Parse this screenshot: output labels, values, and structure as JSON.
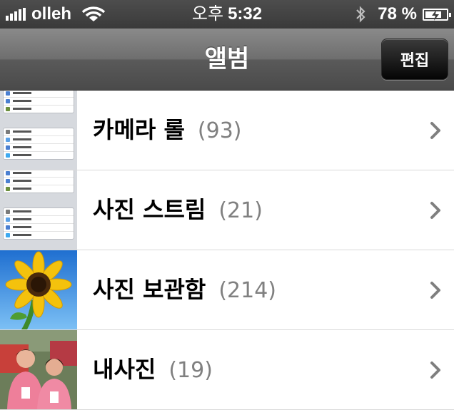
{
  "status_bar": {
    "carrier": "olleh",
    "ampm": "오후",
    "time": "5:32",
    "battery_percent": "78 %",
    "battery_level": 0.78,
    "icons": [
      "signal-bars-icon",
      "wifi-icon",
      "bluetooth-icon",
      "battery-charging-icon"
    ]
  },
  "nav": {
    "title": "앨범",
    "edit_label": "편집"
  },
  "albums": [
    {
      "name": "카메라 롤",
      "count": "(93)",
      "thumbnail": "settings-screenshot"
    },
    {
      "name": "사진 스트림",
      "count": "(21)",
      "thumbnail": "settings-screenshot"
    },
    {
      "name": "사진 보관함",
      "count": "(214)",
      "thumbnail": "sunflower-photo"
    },
    {
      "name": "내사진",
      "count": "(19)",
      "thumbnail": "people-photo"
    }
  ],
  "colors": {
    "accent_text": "#000000",
    "count_text": "#808080",
    "chevron": "#7f7f7f"
  }
}
